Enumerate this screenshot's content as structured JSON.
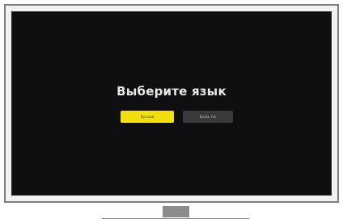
{
  "screen": {
    "title": "Выберите язык",
    "buttons": [
      {
        "label": "Русский",
        "state": "selected",
        "color": "#f3df0b"
      },
      {
        "label": "Қазақ тілі",
        "state": "normal",
        "color": "#3a3a3c"
      }
    ]
  },
  "colors": {
    "screen_background": "#0f0f11",
    "bezel": "#7d7d7d",
    "accent": "#f3df0b"
  }
}
